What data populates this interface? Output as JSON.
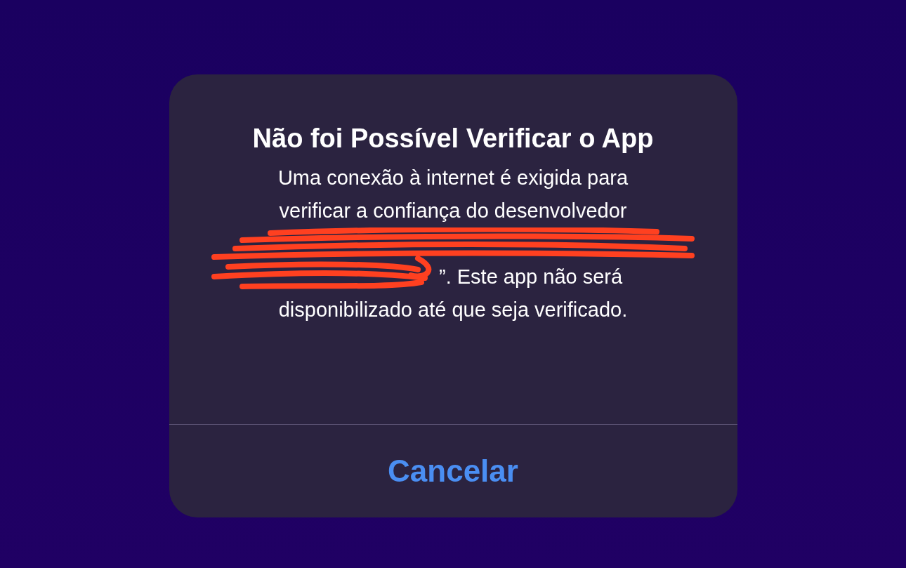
{
  "alert": {
    "title": "Não foi Possível Verificar o App",
    "message_lines": [
      "Uma conexão à internet é exigida para verificar a confiança do desenvolvedor",
      "”. Este app não será",
      "disponibilizado até que seja verificado."
    ],
    "redacted": true,
    "buttons": [
      {
        "label": "Cancelar",
        "kind": "cancel"
      }
    ]
  }
}
